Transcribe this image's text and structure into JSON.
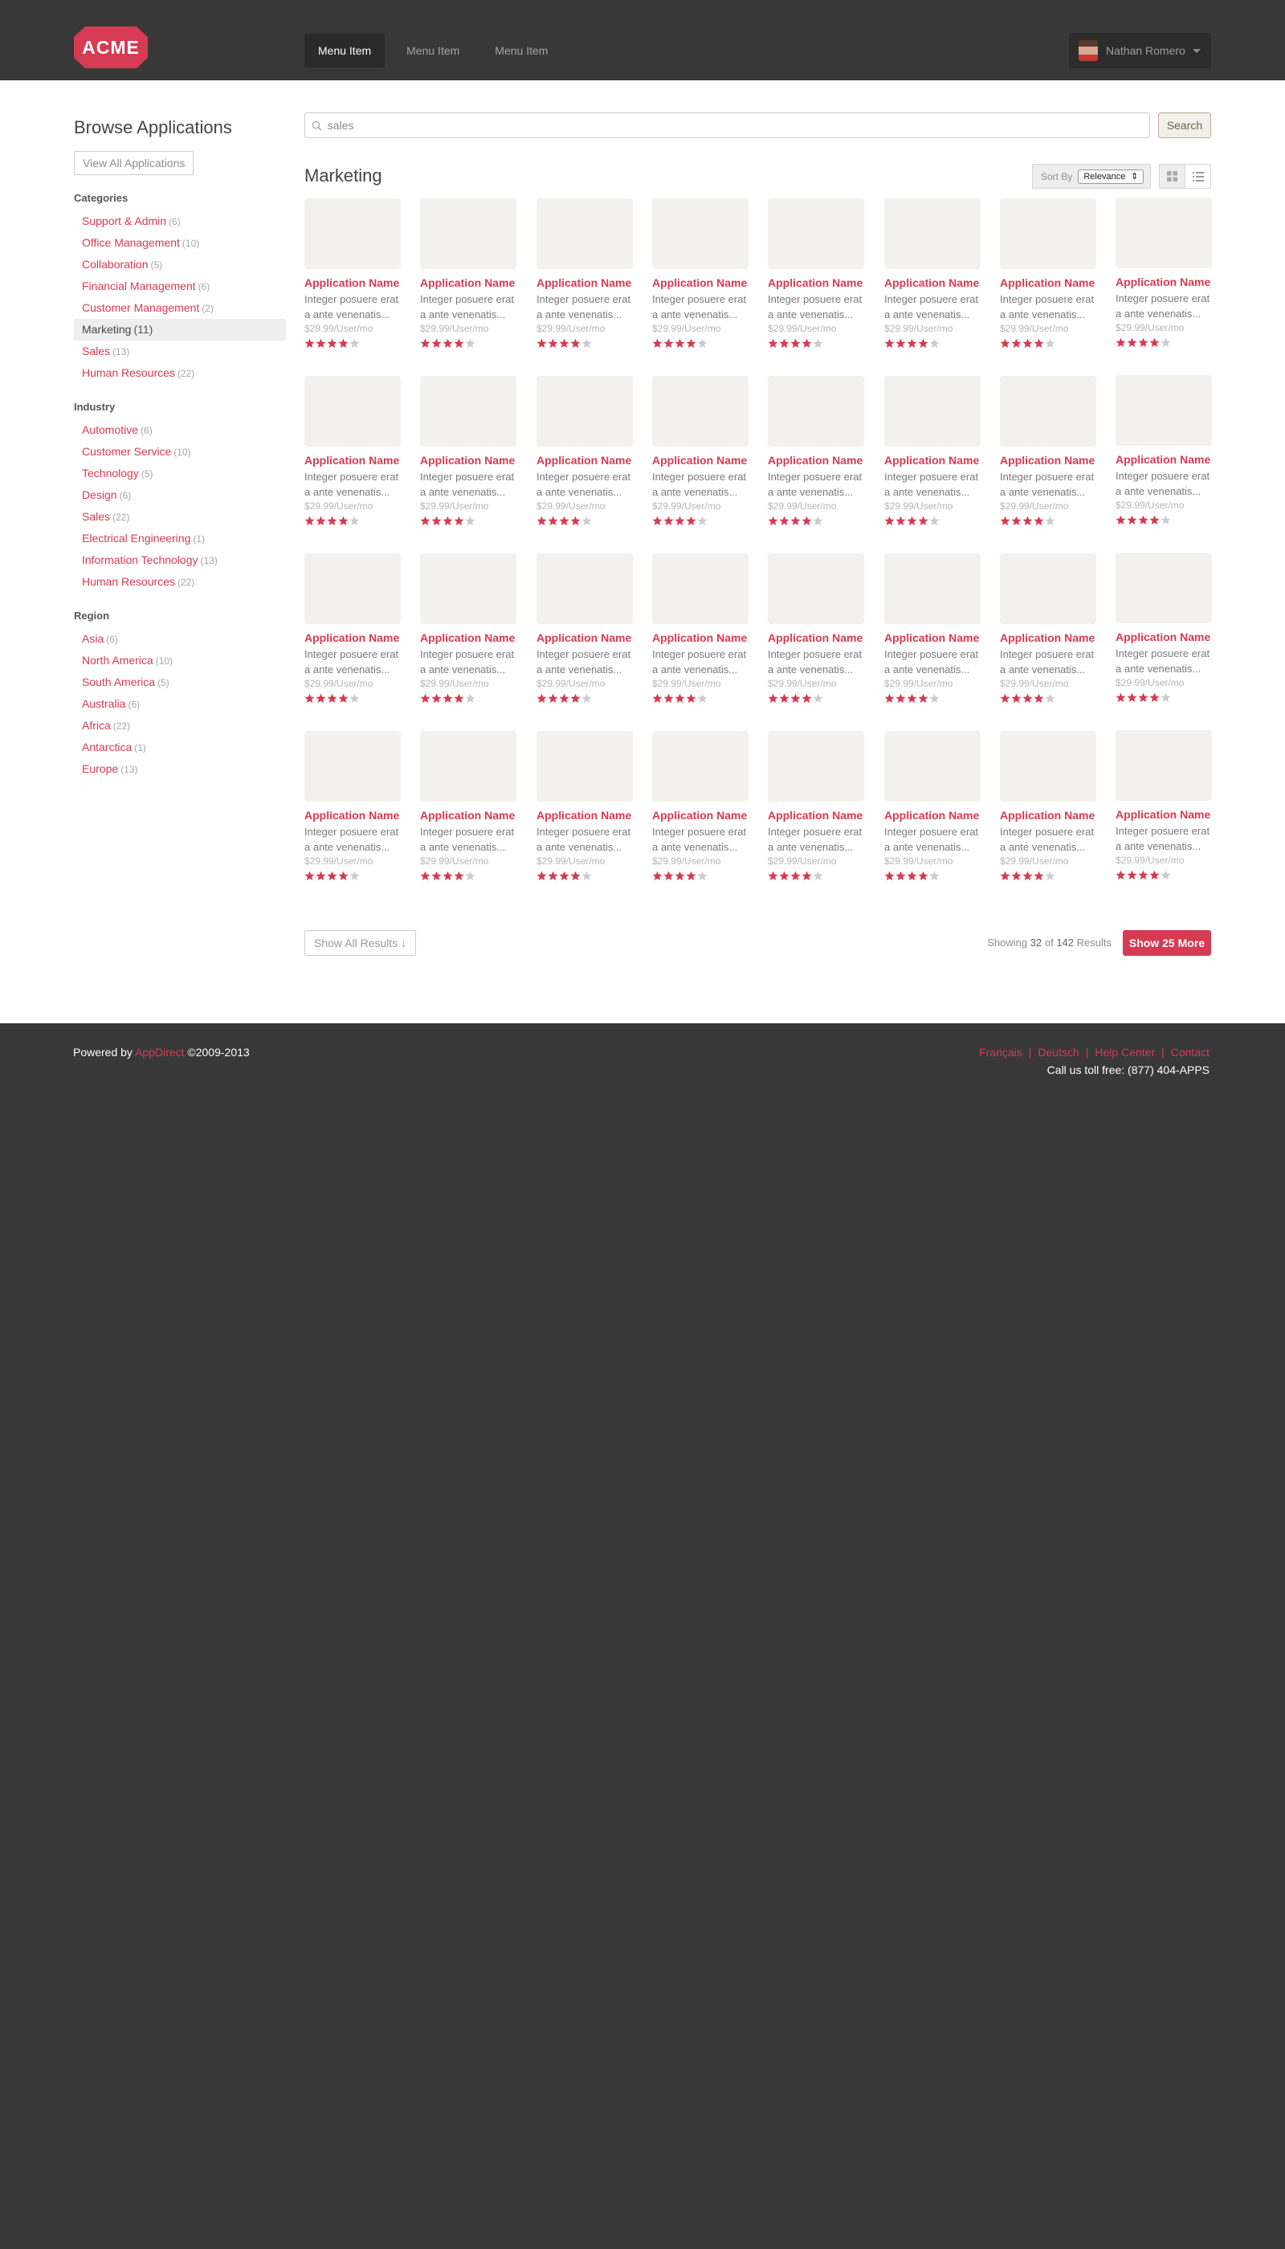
{
  "header": {
    "logo_text": "ACME",
    "nav": [
      "Menu Item",
      "Menu Item",
      "Menu Item"
    ],
    "user_name": "Nathan Romero"
  },
  "sidebar": {
    "title": "Browse Applications",
    "view_all_label": "View All Applications",
    "groups": [
      {
        "title": "Categories",
        "items": [
          {
            "label": "Support & Admin",
            "count": "(6)"
          },
          {
            "label": "Office Management",
            "count": "(10)"
          },
          {
            "label": "Collaboration",
            "count": "(5)"
          },
          {
            "label": "Financial Management",
            "count": "(6)"
          },
          {
            "label": "Customer Management",
            "count": "(2)"
          },
          {
            "label": "Marketing",
            "count": "(11)",
            "selected": true
          },
          {
            "label": "Sales",
            "count": "(13)"
          },
          {
            "label": "Human Resources",
            "count": "(22)"
          }
        ]
      },
      {
        "title": "Industry",
        "items": [
          {
            "label": "Automotive",
            "count": "(6)"
          },
          {
            "label": "Customer Service",
            "count": "(10)"
          },
          {
            "label": "Technology",
            "count": "(5)"
          },
          {
            "label": "Design",
            "count": "(6)"
          },
          {
            "label": "Sales",
            "count": "(22)"
          },
          {
            "label": "Electrical Engineering",
            "count": "(1)"
          },
          {
            "label": "Information Technology",
            "count": "(13)"
          },
          {
            "label": "Human Resources",
            "count": "(22)"
          }
        ]
      },
      {
        "title": "Region",
        "items": [
          {
            "label": "Asia",
            "count": "(6)"
          },
          {
            "label": "North America",
            "count": "(10)"
          },
          {
            "label": "South America",
            "count": "(5)"
          },
          {
            "label": "Australia",
            "count": "(6)"
          },
          {
            "label": "Africa",
            "count": "(22)"
          },
          {
            "label": "Antarctica",
            "count": "(1)"
          },
          {
            "label": "Europe",
            "count": "(13)"
          }
        ]
      }
    ]
  },
  "search": {
    "value": "sales",
    "button_label": "Search"
  },
  "section": {
    "title": "Marketing",
    "sort_label": "Sort By",
    "sort_value": "Relevance"
  },
  "app_card": {
    "name": "Application Name",
    "description": "Integer posuere erat a ante venenatis...",
    "price": "$29.99/User/mo",
    "rating": 4,
    "rating_max": 5
  },
  "grid": {
    "rows": 4,
    "columns": 8
  },
  "results": {
    "show_all_label": "Show All Results ↓",
    "showing_prefix": "Showing",
    "shown": "32",
    "of": "of",
    "total": "142",
    "suffix": "Results",
    "show_more_label": "Show 25 More"
  },
  "footer": {
    "powered_prefix": "Powered by",
    "powered_link": "AppDirect",
    "copyright": "©2009-2013",
    "links": [
      "Français",
      "Deutsch",
      "Help Center",
      "Contact"
    ],
    "toll_free": "Call us toll free: (877) 404-APPS"
  },
  "colors": {
    "accent": "#d53b52",
    "dark_bg": "#383838",
    "star_on": "#d53b52",
    "star_off": "#cccccc",
    "thumb_bg": "#f2f1ee"
  }
}
